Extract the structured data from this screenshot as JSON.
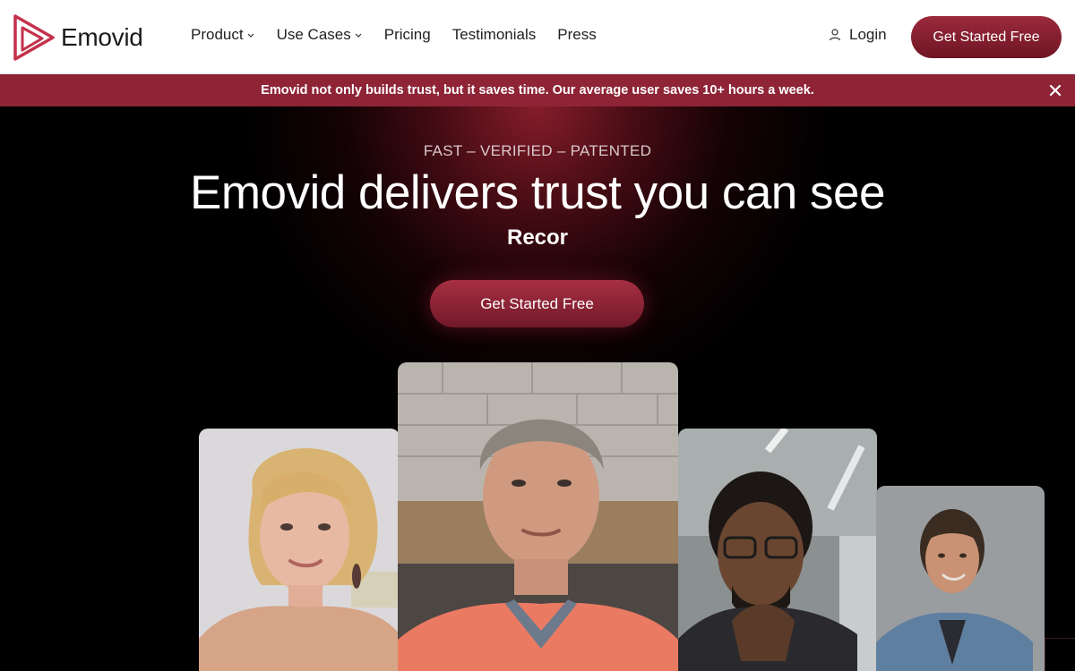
{
  "brand": {
    "name": "Emovid",
    "color": "#9b2a3c"
  },
  "nav": {
    "items": [
      {
        "label": "Product",
        "dropdown": true
      },
      {
        "label": "Use Cases",
        "dropdown": true
      },
      {
        "label": "Pricing",
        "dropdown": false
      },
      {
        "label": "Testimonials",
        "dropdown": false
      },
      {
        "label": "Press",
        "dropdown": false
      }
    ],
    "login_label": "Login",
    "cta_label": "Get Started Free"
  },
  "announcement": {
    "text": "Emovid not only builds trust, but it saves time. Our average user saves 10+ hours a week.",
    "bg_color": "#8e2436"
  },
  "hero": {
    "eyebrow": "FAST – VERIFIED – PATENTED",
    "headline": "Emovid delivers trust you can see",
    "subline": "Recor",
    "cta_label": "Get Started Free"
  },
  "videos": [
    {
      "subject": "woman-blonde-peach-blouse"
    },
    {
      "subject": "man-grey-hair-coral-sweater"
    },
    {
      "subject": "man-glasses-dark-suit"
    },
    {
      "subject": "woman-denim-shirt"
    }
  ]
}
